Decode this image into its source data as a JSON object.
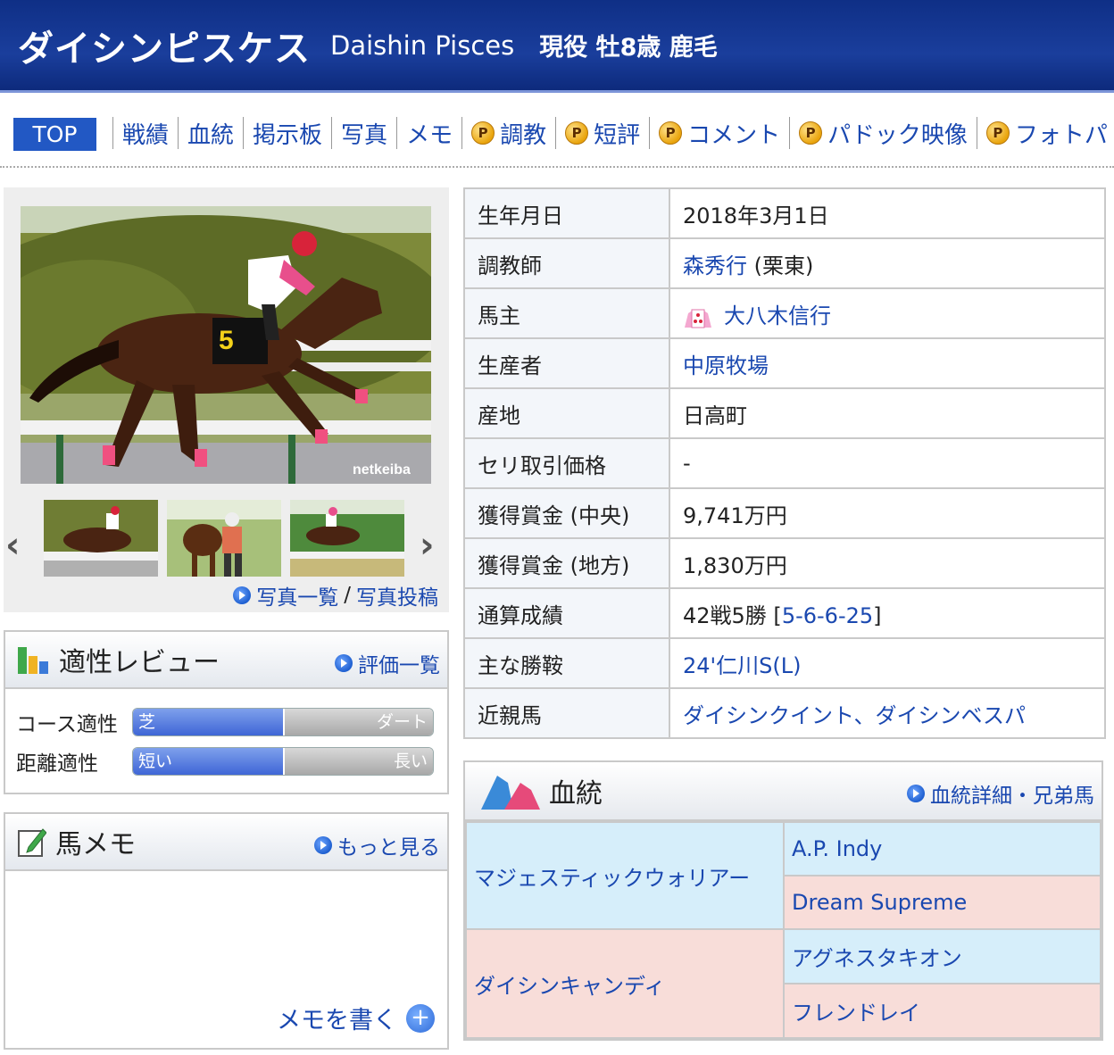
{
  "header": {
    "name_ja": "ダイシンピスケス",
    "name_en": "Daishin Pisces",
    "status": "現役 牡8歳 鹿毛"
  },
  "nav": {
    "top": "TOP",
    "items": [
      "戦績",
      "血統",
      "掲示板",
      "写真",
      "メモ"
    ],
    "premium_badge": "P",
    "premium_items": [
      "調教",
      "短評",
      "コメント",
      "パドック映像",
      "フォトパ"
    ]
  },
  "photos": {
    "watermark": "netkeiba",
    "saddle_number": "5",
    "link_list": "写真一覧",
    "link_sep": "/",
    "link_post": "写真投稿"
  },
  "aptitude": {
    "title": "適性レビュー",
    "link": "評価一覧",
    "course_label": "コース適性",
    "course_left": "芝",
    "course_right": "ダート",
    "course_value": 0.5,
    "distance_label": "距離適性",
    "distance_left": "短い",
    "distance_right": "長い",
    "distance_value": 0.5
  },
  "memo": {
    "title": "馬メモ",
    "link": "もっと見る",
    "write": "メモを書く"
  },
  "profile": {
    "rows": [
      {
        "key": "生年月日",
        "value": "2018年3月1日"
      },
      {
        "key": "調教師",
        "link": "森秀行",
        "value": " (栗東)"
      },
      {
        "key": "馬主",
        "link": "大八木信行"
      },
      {
        "key": "生産者",
        "link": "中原牧場"
      },
      {
        "key": "産地",
        "value": "日高町"
      },
      {
        "key": "セリ取引価格",
        "value": "-"
      },
      {
        "key": "獲得賞金 (中央)",
        "value": "9,741万円"
      },
      {
        "key": "獲得賞金 (地方)",
        "value": "1,830万円"
      },
      {
        "key": "通算成績",
        "value": "42戦5勝 [",
        "link": "5-6-6-25",
        "tail": "]"
      },
      {
        "key": "主な勝鞍",
        "link": "24'仁川S(L)"
      },
      {
        "key": "近親馬",
        "link": "ダイシンクイント、ダイシンベスパ"
      }
    ]
  },
  "pedigree": {
    "title": "血統",
    "link": "血統詳細・兄弟馬",
    "sire": "マジェスティックウォリアー",
    "sire_sire": "A.P. Indy",
    "sire_dam": "Dream Supreme",
    "dam": "ダイシンキャンディ",
    "dam_sire": "アグネスタキオン",
    "dam_dam": "フレンドレイ"
  },
  "colors": {
    "header_bg": "#1a3e9c",
    "link": "#1a48b0",
    "top_tab": "#2258c4",
    "male_bg": "#d6eefa",
    "female_bg": "#f8ddd9"
  }
}
